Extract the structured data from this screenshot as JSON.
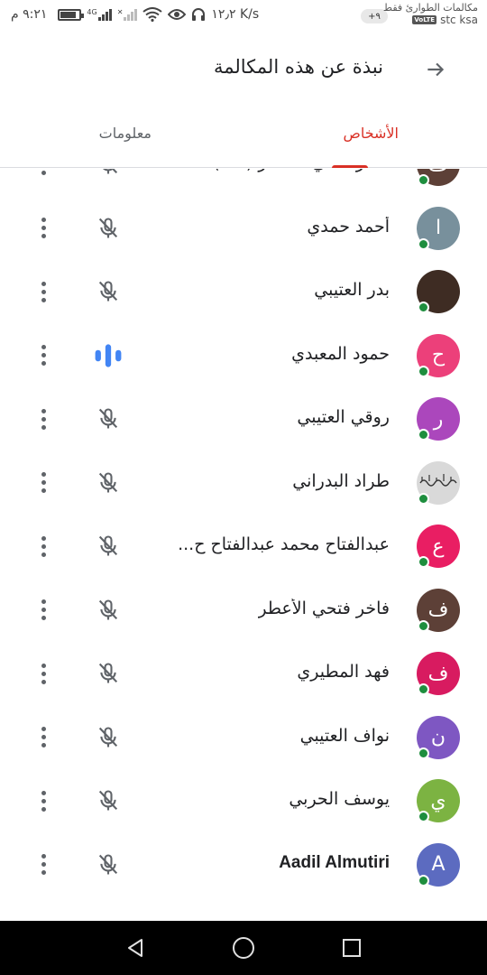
{
  "status_bar": {
    "time": "٩:٢١ م",
    "speed": "١٢٫٢ K/s",
    "network": "4G",
    "carrier_top": "مكالمات الطوارئ فقط",
    "carrier_bottom": "stc ksa",
    "volte": "VoLTE",
    "notification_count": "+٩",
    "battery_level": 0.85
  },
  "header": {
    "title": "نبذة عن هذه المكالمة",
    "back_icon": "arrow-right-icon"
  },
  "tabs": {
    "people": "الأشخاص",
    "info": "معلومات",
    "active": "people",
    "active_color": "#d93025"
  },
  "participants": [
    {
      "name": "فاخر فتحي الأعطر (أنت)",
      "initial": "ف",
      "color": "#5d4037",
      "mic": "muted"
    },
    {
      "name": "أحمد حمدي",
      "initial": "ا",
      "color": "#78909c",
      "mic": "muted"
    },
    {
      "name": "بدر العتيبي",
      "initial": "",
      "color": "#3e2c23",
      "mic": "muted",
      "avatar_type": "photo"
    },
    {
      "name": "حمود المعبدي",
      "initial": "ح",
      "color": "#ec407a",
      "mic": "speaking"
    },
    {
      "name": "روقي العتيبي",
      "initial": "ر",
      "color": "#ab47bc",
      "mic": "muted"
    },
    {
      "name": "طراد البدراني",
      "initial": "",
      "color": "#d9d9d9",
      "mic": "muted",
      "avatar_type": "calligraphy"
    },
    {
      "name": "عبدالفتاح محمد عبدالفتاح ح...",
      "initial": "ع",
      "color": "#e91e63",
      "mic": "muted"
    },
    {
      "name": "فاخر فتحي الأعطر",
      "initial": "ف",
      "color": "#5d4037",
      "mic": "muted"
    },
    {
      "name": "فهد المطيري",
      "initial": "ف",
      "color": "#d81b60",
      "mic": "muted"
    },
    {
      "name": "نواف العتيبي",
      "initial": "ن",
      "color": "#7e57c2",
      "mic": "muted"
    },
    {
      "name": "يوسف الحربي",
      "initial": "ي",
      "color": "#7cb342",
      "mic": "muted"
    },
    {
      "name": "Aadil Almutiri",
      "initial": "A",
      "color": "#5c6bc0",
      "mic": "muted",
      "latin": true
    }
  ],
  "colors": {
    "online": "#1e8e3e",
    "speaking": "#4285f4",
    "muted_icon": "#5f6368"
  },
  "icons": {
    "mic_muted": "mic-off-icon",
    "mic_speaking": "audio-level-icon",
    "more": "more-vert-icon",
    "nav_back": "nav-back-icon",
    "nav_home": "nav-home-icon",
    "nav_recents": "nav-recents-icon"
  }
}
